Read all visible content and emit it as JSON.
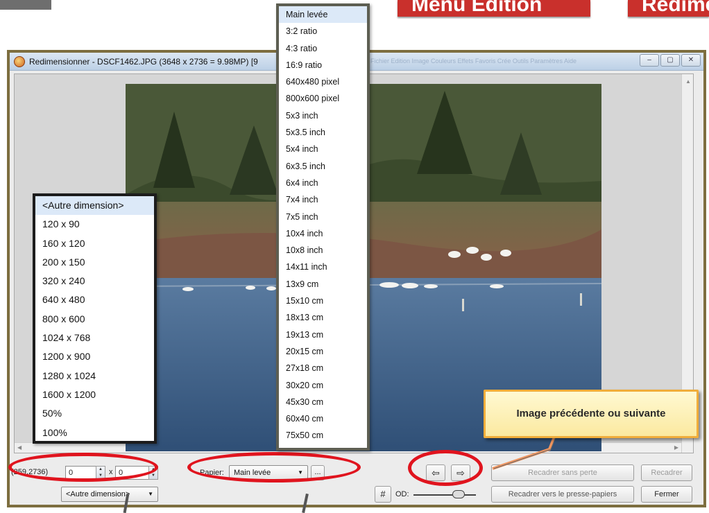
{
  "banners": {
    "left": "Menu Édition",
    "right": "Redimensionner"
  },
  "window": {
    "title": "Redimensionner - DSCF1462.JPG (3648 x 2736 = 9.98MP) [9",
    "menu_ghost": "Fichier  Edition  Image  Couleurs  Effets  Favoris  Crée  Outils  Paramètres  Aide",
    "minimize": "–",
    "maximize": "▢",
    "close": "✕"
  },
  "controls": {
    "dims_prefix": "(259,2736)",
    "width_value": "0",
    "times": "x",
    "height_value": "0",
    "preset_combo": "<Autre dimension>",
    "paper_label": "Papier:",
    "paper_combo": "Main levée",
    "ellipsis": "...",
    "prev": "⇦",
    "next": "⇨",
    "crop_lossless": "Recadrer sans perte",
    "crop": "Recadrer",
    "grid": "#",
    "od_label": "OD:",
    "crop_clipboard": "Recadrer vers le presse-papiers",
    "close_button": "Fermer"
  },
  "dimension_list": [
    "<Autre dimension>",
    "120 x 90",
    "160 x 120",
    "200 x 150",
    "320 x 240",
    "640 x 480",
    "800 x 600",
    "1024 x 768",
    "1200 x 900",
    "1280 x 1024",
    "1600 x 1200",
    "50%",
    "100%"
  ],
  "paper_list": [
    "Main levée",
    "3:2 ratio",
    "4:3 ratio",
    "16:9 ratio",
    "640x480 pixel",
    "800x600 pixel",
    "5x3 inch",
    "5x3.5 inch",
    "5x4 inch",
    "6x3.5 inch",
    "6x4 inch",
    "7x4 inch",
    "7x5 inch",
    "10x4 inch",
    "10x8 inch",
    "14x11 inch",
    "13x9 cm",
    "15x10 cm",
    "18x13 cm",
    "19x13 cm",
    "20x15 cm",
    "27x18 cm",
    "30x20 cm",
    "45x30 cm",
    "60x40 cm",
    "75x50 cm"
  ],
  "callout": "Image précédente ou suivante",
  "colors": {
    "annotation_red": "#e0141e",
    "callout_border": "#f0ad3b",
    "list_selected": "#dce9f8"
  }
}
